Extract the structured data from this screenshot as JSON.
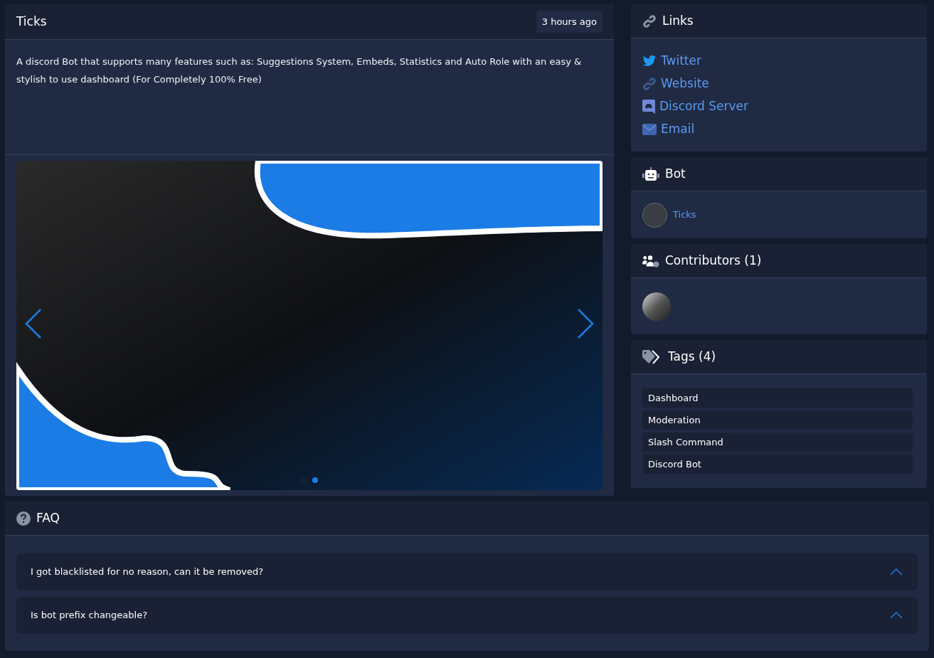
{
  "bot_card": {
    "title": "Ticks",
    "time": "3 hours ago",
    "description": "A discord Bot that supports many features such as: Suggestions System, Embeds, Statistics and Auto Role with an easy & stylish to use dashboard (For Completely 100% Free)",
    "carousel": {
      "slides": [
        {
          "selected": false
        },
        {
          "selected": true
        }
      ]
    }
  },
  "links": {
    "title": "Links",
    "items": [
      {
        "kind": "twitter",
        "label": "Twitter"
      },
      {
        "kind": "website",
        "label": "Website"
      },
      {
        "kind": "discord",
        "label": "Discord Server"
      },
      {
        "kind": "email",
        "label": "Email"
      }
    ]
  },
  "bot": {
    "title": "Bot",
    "name": "Ticks"
  },
  "contributors": {
    "title": "Contributors (1)",
    "count_avatars": [
      {
        "kind": "avatar"
      }
    ]
  },
  "tags": {
    "title": "Tags (4)",
    "items": [
      "Dashboard",
      "Moderation",
      "Slash Command",
      "Discord Bot"
    ]
  },
  "faq": {
    "title": "FAQ",
    "items": [
      "I got blacklisted for no reason, can it be removed?",
      "Is bot prefix changeable?"
    ]
  }
}
